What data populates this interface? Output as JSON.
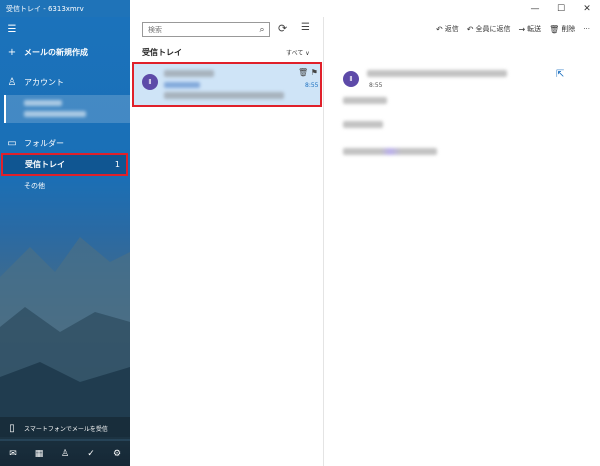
{
  "window": {
    "title": "受信トレイ - 6313xmrv",
    "minimize_glyph": "—",
    "maximize_glyph": "☐",
    "close_glyph": "✕"
  },
  "sidebar": {
    "menu_glyph": "☰",
    "new_mail": {
      "icon": "+",
      "label": "メールの新規作成"
    },
    "account": {
      "icon": "♙",
      "label": "アカウント"
    },
    "folders": {
      "icon": "▭",
      "label": "フォルダー"
    },
    "inbox": {
      "label": "受信トレイ",
      "count": "1"
    },
    "other": {
      "label": "その他"
    },
    "smartphone": {
      "icon": "▯",
      "label": "スマートフォンでメールを受信"
    },
    "bottom": [
      {
        "name": "mail-icon",
        "glyph": "✉"
      },
      {
        "name": "calendar-icon",
        "glyph": "▦"
      },
      {
        "name": "people-icon",
        "glyph": "♙"
      },
      {
        "name": "todo-icon",
        "glyph": "✓"
      },
      {
        "name": "settings-icon",
        "glyph": "⚙"
      }
    ]
  },
  "list": {
    "search_placeholder": "検索",
    "search_glyph": "⌕",
    "sync_glyph": "⟳",
    "select_glyph": "☰",
    "title": "受信トレイ",
    "filter": "すべて ∨",
    "message": {
      "avatar": "Ⅱ",
      "time": "8:55",
      "actions": "🗑 ⚑"
    }
  },
  "reading": {
    "reply": {
      "glyph": "↶",
      "label": "返信"
    },
    "reply_all": {
      "glyph": "↶",
      "label": "全員に返信"
    },
    "forward": {
      "glyph": "→",
      "label": "転送"
    },
    "delete": {
      "glyph": "🗑",
      "label": "削除"
    },
    "more": "···",
    "avatar": "Ⅱ",
    "time": "8:55",
    "popout_glyph": "⇱"
  },
  "colors": {
    "accent": "#1f73b8",
    "selection": "#cfe4f7",
    "highlight": "#e0202a",
    "avatar": "#5d4aa8"
  }
}
